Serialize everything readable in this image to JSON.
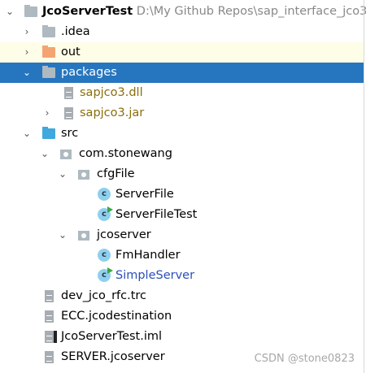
{
  "project": {
    "name": "JcoServerTest",
    "path": "D:\\My Github Repos\\sap_interface_jco3"
  },
  "items": [
    {
      "label": ".idea"
    },
    {
      "label": "out"
    },
    {
      "label": "packages"
    },
    {
      "label": "sapjco3.dll"
    },
    {
      "label": "sapjco3.jar"
    },
    {
      "label": "src"
    },
    {
      "label": "com.stonewang"
    },
    {
      "label": "cfgFile"
    },
    {
      "label": "ServerFile"
    },
    {
      "label": "ServerFileTest"
    },
    {
      "label": "jcoserver"
    },
    {
      "label": "FmHandler"
    },
    {
      "label": "SimpleServer"
    },
    {
      "label": "dev_jco_rfc.trc"
    },
    {
      "label": "ECC.jcodestination"
    },
    {
      "label": "JcoServerTest.iml"
    },
    {
      "label": "SERVER.jcoserver"
    }
  ],
  "class_icon_letter": "c",
  "watermark": "CSDN @stone0823",
  "colors": {
    "selection": "#2675bf",
    "hover": "#fefde7",
    "library_text": "#8a6d0b",
    "run_class_text": "#2a4fb8"
  }
}
